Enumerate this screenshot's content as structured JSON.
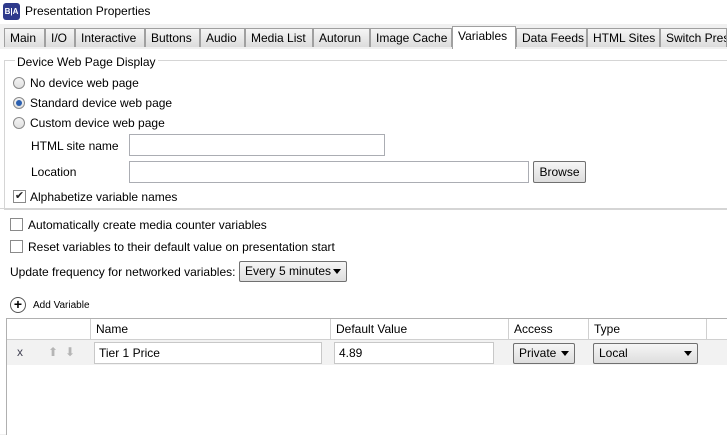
{
  "window": {
    "app_icon_text": "B|A",
    "title": "Presentation Properties"
  },
  "tabs": [
    "Main",
    "I/O",
    "Interactive",
    "Buttons",
    "Audio",
    "Media List",
    "Autorun",
    "Image Cache",
    "Variables",
    "Data Feeds",
    "HTML Sites",
    "Switch Pres"
  ],
  "active_tab": "Variables",
  "device_web_page": {
    "legend": "Device Web Page Display",
    "options": [
      "No device web page",
      "Standard device web page",
      "Custom device web page"
    ],
    "selected": "Standard device web page",
    "html_site_name_label": "HTML site name",
    "html_site_name_value": "",
    "location_label": "Location",
    "location_value": "",
    "browse_label": "Browse",
    "alphabetize_label": "Alphabetize variable names",
    "alphabetize_checked": true
  },
  "options": {
    "auto_media_counter_label": "Automatically create media counter variables",
    "auto_media_counter_checked": false,
    "reset_variables_label": "Reset variables to their default value on presentation start",
    "reset_variables_checked": false,
    "update_frequency_label": "Update frequency for networked variables:",
    "update_frequency_value": "Every 5 minutes"
  },
  "add_variable": {
    "icon_glyph": "+",
    "label": "Add Variable"
  },
  "variables_table": {
    "columns": [
      "Name",
      "Default Value",
      "Access",
      "Type"
    ],
    "rows": [
      {
        "delete": "x",
        "name": "Tier 1 Price",
        "default_value": "4.89",
        "access": "Private",
        "type": "Local"
      }
    ]
  }
}
